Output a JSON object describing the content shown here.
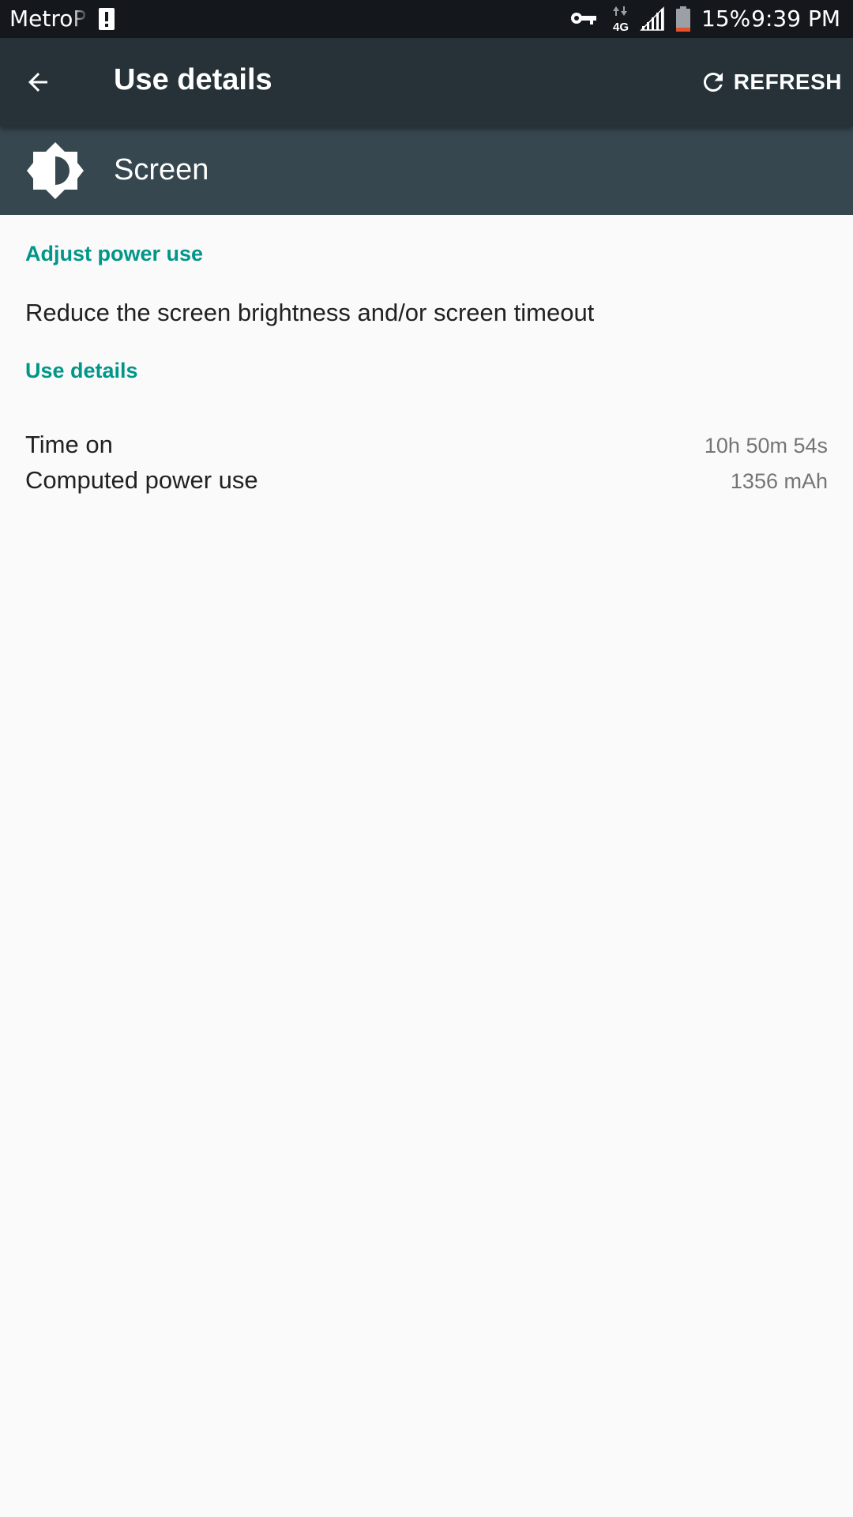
{
  "status_bar": {
    "carrier": "MetroPCS",
    "battery_percent": "15%",
    "time": "9:39 PM",
    "network_type": "4G",
    "icons": [
      "alert-icon",
      "vpn-key-icon",
      "mobile-data-icon",
      "signal-icon",
      "battery-icon"
    ]
  },
  "app_bar": {
    "title": "Use details",
    "back_icon": "arrow-back-icon",
    "refresh_label": "REFRESH",
    "refresh_icon": "refresh-icon"
  },
  "app_header": {
    "name": "Screen",
    "icon": "brightness-icon"
  },
  "sections": {
    "adjust_power": {
      "header": "Adjust power use",
      "text": "Reduce the screen brightness and/or screen timeout"
    },
    "use_details": {
      "header": "Use details",
      "rows": [
        {
          "label": "Time on",
          "value": "10h 50m 54s"
        },
        {
          "label": "Computed power use",
          "value": "1356 mAh"
        }
      ]
    }
  },
  "colors": {
    "accent": "#009688",
    "app_bar": "#263238",
    "header_row": "#37474f",
    "status_bar": "#14181c",
    "battery_low": "#e5532d"
  }
}
